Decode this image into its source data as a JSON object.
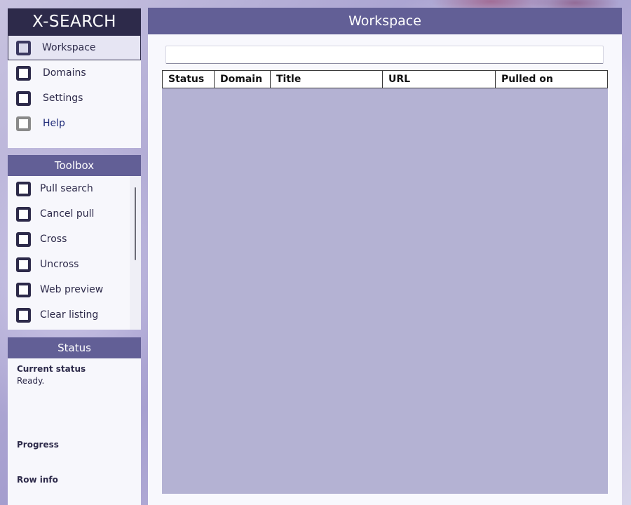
{
  "brand": {
    "title": "X-SEARCH"
  },
  "nav": {
    "items": [
      {
        "label": "Workspace",
        "active": true,
        "icon": "workspace-icon"
      },
      {
        "label": "Domains",
        "active": false,
        "icon": "domains-icon"
      },
      {
        "label": "Settings",
        "active": false,
        "icon": "settings-icon"
      },
      {
        "label": "Help",
        "active": false,
        "icon": "help-icon"
      }
    ]
  },
  "toolbox": {
    "title": "Toolbox",
    "items": [
      {
        "label": "Pull search",
        "icon": "pull-search-icon"
      },
      {
        "label": "Cancel pull",
        "icon": "cancel-pull-icon"
      },
      {
        "label": "Cross",
        "icon": "cross-icon"
      },
      {
        "label": "Uncross",
        "icon": "uncross-icon"
      },
      {
        "label": "Web preview",
        "icon": "web-preview-icon"
      },
      {
        "label": "Clear listing",
        "icon": "clear-listing-icon"
      }
    ]
  },
  "status": {
    "title": "Status",
    "current_status_label": "Current status",
    "current_status_value": "Ready.",
    "progress_label": "Progress",
    "row_info_label": "Row info"
  },
  "workspace": {
    "title": "Workspace",
    "search": {
      "value": "",
      "placeholder": ""
    },
    "columns": [
      "Status",
      "Domain",
      "Title",
      "URL",
      "Pulled on"
    ],
    "rows": []
  },
  "colors": {
    "brand_bg": "#2d2a4a",
    "header_bg": "#625f96",
    "panel_bg": "#f7f7fc",
    "grid_bg": "#b4b2d3"
  }
}
